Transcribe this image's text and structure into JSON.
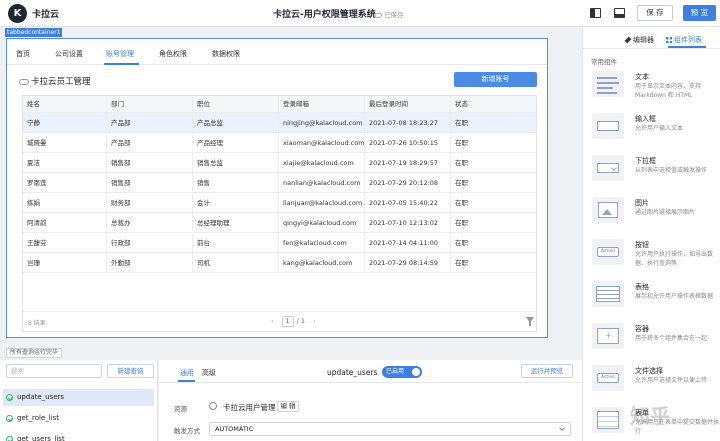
{
  "topbar": {
    "brand": "卡拉云",
    "title": "卡拉云-用户权限管理系统",
    "saved_status": "已保存",
    "save_label": "保 存",
    "preview_label": "预 览"
  },
  "canvas": {
    "container_label": "tabbedcontainer1",
    "tabs": [
      {
        "label": "首页"
      },
      {
        "label": "公司设置"
      },
      {
        "label": "账号管理"
      },
      {
        "label": "角色权限"
      },
      {
        "label": "数据权限"
      }
    ],
    "active_tab": "账号管理",
    "table_title": "卡拉云员工管理",
    "add_button": "新增账号",
    "table": {
      "columns": [
        "姓名",
        "部门",
        "职位",
        "登录邮箱",
        "最后登录时间",
        "状态"
      ],
      "rows": [
        [
          "宁静",
          "产品部",
          "产品总监",
          "ningjing@kalacloud.com",
          "2021-07-08 18:23:27",
          "在职"
        ],
        [
          "城晓曼",
          "产品部",
          "产品经理",
          "xiaoman@kalacloud.com",
          "2021-07-26 10:50:15",
          "在职"
        ],
        [
          "夏洁",
          "销售部",
          "销售总监",
          "xiajie@kalacloud.com",
          "2021-07-19 18:29:57",
          "在职"
        ],
        [
          "罗南莲",
          "销售部",
          "销售",
          "nanlian@kalacloud.com",
          "2021-07-29 20:12:08",
          "在职"
        ],
        [
          "练娟",
          "财务部",
          "会计",
          "lianjuan@kalacloud.com",
          "2021-07-05 15:40:22",
          "在职"
        ],
        [
          "阿清韵",
          "总裁办",
          "总经理助理",
          "qingyi@kalacloud.com",
          "2021-07-10 12:13:02",
          "在职"
        ],
        [
          "王馥芬",
          "行政部",
          "前台",
          "fen@kalacloud.com",
          "2021-07-14 04:11:00",
          "在职"
        ],
        [
          "岂珊",
          "外勤部",
          "司机",
          "kang@kalacloud.com",
          "2021-07-29 08:14:59",
          "在职"
        ]
      ],
      "count_text": "8 结果",
      "page_current": "1",
      "page_sep": "/",
      "page_total": "1",
      "prev": "‹",
      "next": "›"
    }
  },
  "bottom": {
    "panel_label": "所有查询运行完毕",
    "search_placeholder": "搜索",
    "new_query": "新建查询",
    "queries": [
      {
        "name": "update_users"
      },
      {
        "name": "get_role_list"
      },
      {
        "name": "get_users_list"
      }
    ],
    "editor": {
      "tab_general": "通用",
      "tab_advanced": "高级",
      "query_name": "update_users",
      "enabled_badge": "已启用",
      "run_button": "运行并预览",
      "resource_label": "资源",
      "resource_name": "卡拉云用户管理",
      "edit_button": "编 辑",
      "trigger_label": "触发方式",
      "trigger_value": "AUTOMATIC"
    }
  },
  "right_panel": {
    "tab_editor": "编辑器",
    "tab_components": "组件列表",
    "section": "常用组件",
    "components": [
      {
        "name": "文本",
        "desc": "用于显示文本内容，支持Markdown 和 HTML",
        "icon": "text-icon"
      },
      {
        "name": "输入框",
        "desc": "允许用户输入文本",
        "icon": "input-icon"
      },
      {
        "name": "下拉框",
        "desc": "从列表中选择值或触发操作",
        "icon": "select-icon"
      },
      {
        "name": "图片",
        "desc": "通过图片链接展示图片",
        "icon": "image-icon"
      },
      {
        "name": "按钮",
        "desc": "允许用户执行操作，如导出数据、执行查询等",
        "icon": "button-icon"
      },
      {
        "name": "表格",
        "desc": "展示和允许用户操作表格数据",
        "icon": "table-icon"
      },
      {
        "name": "容器",
        "desc": "用于将多个组件集合在一起",
        "icon": "container-icon"
      },
      {
        "name": "文件选择",
        "desc": "允许用户选择文件以便上传",
        "icon": "file-icon"
      },
      {
        "name": "表单",
        "desc": "允许用户在表单中提交数据并执行",
        "icon": "form-icon"
      }
    ],
    "thumb_button_text": "Action"
  },
  "watermark": "知乎"
}
